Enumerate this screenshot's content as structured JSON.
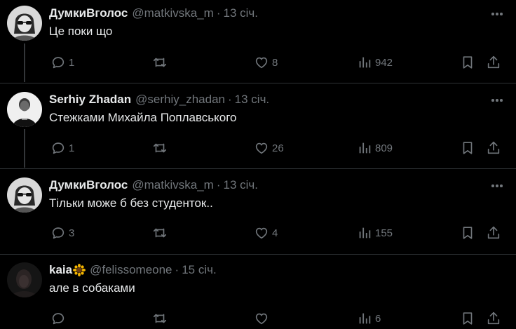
{
  "tweets": [
    {
      "name": "ДумкиВголос",
      "handle": "@matkivska_m",
      "time": "13 січ.",
      "text": "Це поки що",
      "replies": "1",
      "retweets": "",
      "likes": "8",
      "views": "942",
      "avatar": "woman-with-sunglasses"
    },
    {
      "name": "Serhiy Zhadan",
      "handle": "@serhiy_zhadan",
      "time": "13 січ.",
      "text": "Стежками Михайла Поплавського",
      "replies": "1",
      "retweets": "",
      "likes": "26",
      "views": "809",
      "avatar": "man-in-black-shirt"
    },
    {
      "name": "ДумкиВголос",
      "handle": "@matkivska_m",
      "time": "13 січ.",
      "text": "Тільки може б без студенток..",
      "replies": "3",
      "retweets": "",
      "likes": "4",
      "views": "155",
      "avatar": "woman-with-sunglasses"
    },
    {
      "name": "kaia",
      "handle": "@felissomeone",
      "time": "15 січ.",
      "text": "але в собаками",
      "replies": "",
      "retweets": "",
      "likes": "",
      "views": "6",
      "avatar": "dark-photo"
    }
  ],
  "colors": {
    "background": "#000000",
    "text": "#e7e9ea",
    "muted": "#71767b",
    "thread_line": "#333639",
    "separator": "#2f3336"
  },
  "icons": [
    "reply-icon",
    "retweet-icon",
    "like-icon",
    "views-icon",
    "bookmark-icon",
    "share-icon",
    "more-icon",
    "sunflower-emoji"
  ]
}
